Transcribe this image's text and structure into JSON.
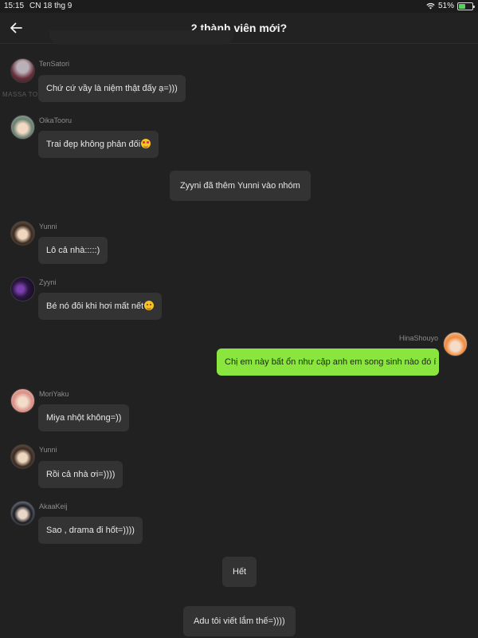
{
  "status_bar": {
    "time": "15:15",
    "date": "CN 18 thg 9",
    "battery": "51%",
    "battery_level": 0.51
  },
  "header": {
    "title": "2 thành viên mới?"
  },
  "watermark": "MASSA TOOL",
  "messages": [
    {
      "sender": "TenSatori",
      "text": "Chứ cứ vầy là niệm thật đấy ạ=)))",
      "avatar": "avatar-tensatori"
    },
    {
      "sender": "OikaTooru",
      "text": "Trai đẹp không phản đối",
      "emoji": "heart-eyes-emoji",
      "avatar": "avatar-oikatooru"
    },
    {
      "system": "Zyyni đã thêm Yunni vào nhóm"
    },
    {
      "sender": "Yunni",
      "text": "Lô cả nhà:::::)",
      "avatar": "avatar-yunni"
    },
    {
      "sender": "Zyyni",
      "text": "Bé nó đôi khi hơi mất nết",
      "emoji": "smile-emoji",
      "avatar": "avatar-zyyni"
    },
    {
      "sender": "HinaShouyo",
      "text": "Chị em này bất ổn như cặp anh em song sinh nào đó í",
      "own": true,
      "avatar": "avatar-hinashouyo"
    },
    {
      "sender": "MoriYaku",
      "text": "Miya nhột không=))",
      "avatar": "avatar-moriyaku"
    },
    {
      "sender": "Yunni",
      "text": "Rồi cả nhà ơi=))))",
      "avatar": "avatar-yunni"
    },
    {
      "sender": "AkaaKeij",
      "text": "Sao , drama đi hốt=))))",
      "avatar": "avatar-akaakeij"
    },
    {
      "system": "Hết"
    },
    {
      "system": "Adu tôi viết lắm thế=))))"
    }
  ],
  "colors": {
    "background": "#212121",
    "bubble": "#333333",
    "own_bubble": "#8ae63e",
    "battery": "#58d15f"
  }
}
